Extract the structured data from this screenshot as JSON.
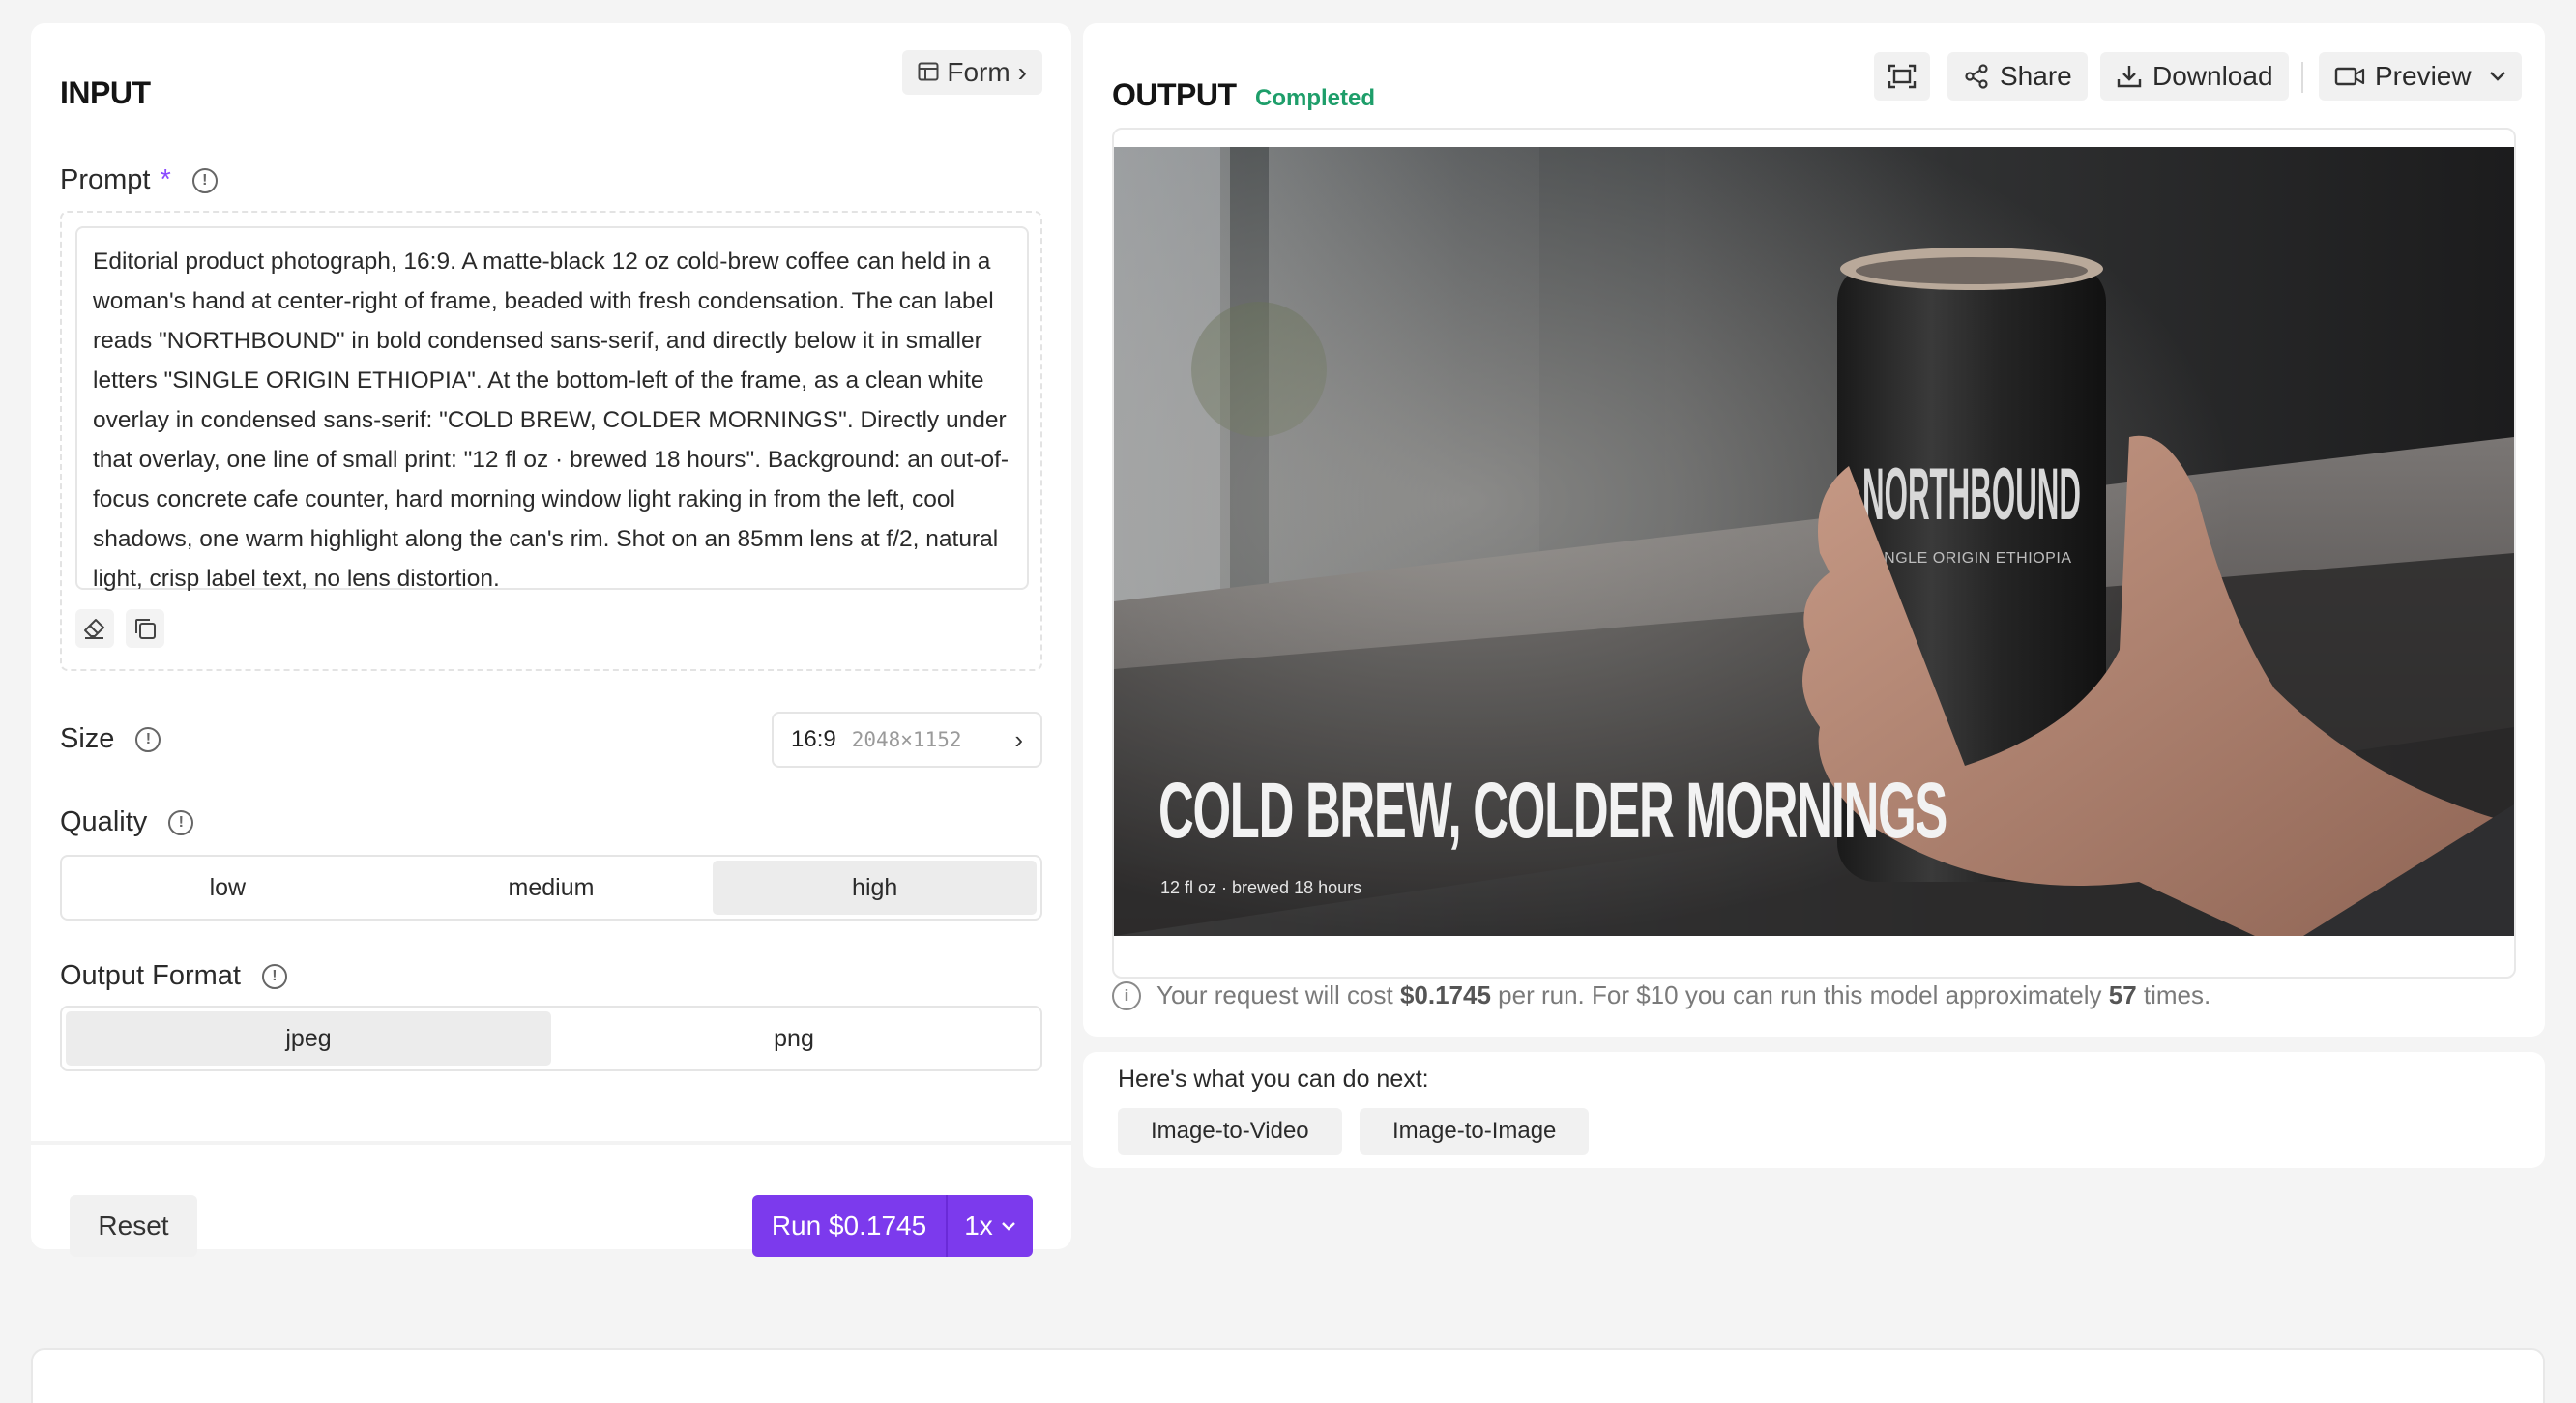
{
  "input": {
    "title": "INPUT",
    "form_button": "Form",
    "prompt": {
      "label": "Prompt",
      "required_mark": "*",
      "value": "Editorial product photograph, 16:9. A matte-black 12 oz cold-brew coffee can held in a woman's hand at center-right of frame, beaded with fresh condensation. The can label reads \"NORTHBOUND\" in bold condensed sans-serif, and directly below it in smaller letters \"SINGLE ORIGIN ETHIOPIA\". At the bottom-left of the frame, as a clean white overlay in condensed sans-serif: \"COLD BREW, COLDER MORNINGS\". Directly under that overlay, one line of small print: \"12 fl oz · brewed 18 hours\". Background: an out-of-focus concrete cafe counter, hard morning window light raking in from the left, cool shadows, one warm highlight along the can's rim. Shot on an 85mm lens at f/2, natural light, crisp label text, no lens distortion."
    },
    "size": {
      "label": "Size",
      "ratio": "16:9",
      "dims": "2048×1152"
    },
    "quality": {
      "label": "Quality",
      "options": [
        "low",
        "medium",
        "high"
      ],
      "selected": "high"
    },
    "output_format": {
      "label": "Output Format",
      "options": [
        "jpeg",
        "png"
      ],
      "selected": "jpeg"
    },
    "reset_label": "Reset",
    "run_label": "Run $0.1745",
    "run_multiplier": "1x"
  },
  "output": {
    "title": "OUTPUT",
    "status": "Completed",
    "share_label": "Share",
    "download_label": "Download",
    "preview_label": "Preview",
    "image": {
      "can_brand": "NORTHBOUND",
      "can_sub": "SINGLE ORIGIN ETHIOPIA",
      "headline": "COLD BREW, COLDER MORNINGS",
      "small_print": "12 fl oz · brewed 18 hours"
    },
    "cost": {
      "prefix": "Your request will cost",
      "amount": "$0.1745",
      "mid": "per run. For $10 you can run this model approximately",
      "count": "57",
      "suffix": "times."
    }
  },
  "next": {
    "title": "Here's what you can do next:",
    "actions": [
      "Image-to-Video",
      "Image-to-Image"
    ]
  },
  "colors": {
    "accent": "#7c3aed",
    "status": "#1e9e6a"
  }
}
